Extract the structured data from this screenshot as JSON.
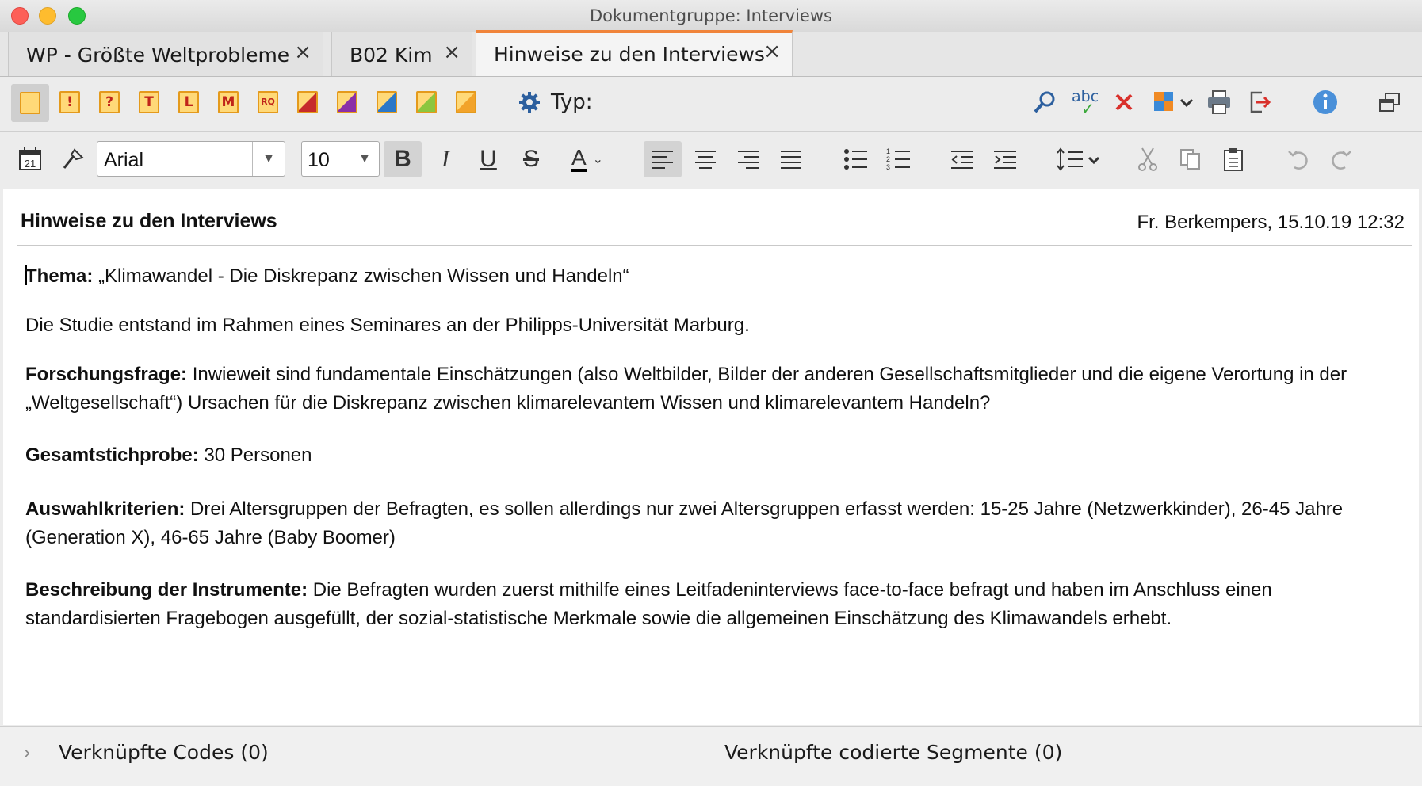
{
  "window": {
    "title": "Dokumentgruppe: Interviews"
  },
  "tabs": [
    {
      "label": "WP - Größte Weltprobleme",
      "close": "×"
    },
    {
      "label": "B02 Kim",
      "close": "×"
    },
    {
      "label": "Hinweise zu den Interviews",
      "close": "×",
      "active": true
    }
  ],
  "toolbar": {
    "memo_types": [
      {
        "icon": "memo-blank-icon",
        "label": ""
      },
      {
        "icon": "memo-exclamation-icon",
        "label": "!"
      },
      {
        "icon": "memo-question-icon",
        "label": "?"
      },
      {
        "icon": "memo-t-icon",
        "label": "T"
      },
      {
        "icon": "memo-l-icon",
        "label": "L"
      },
      {
        "icon": "memo-m-icon",
        "label": "M"
      },
      {
        "icon": "memo-rq-icon",
        "label": "RQ"
      },
      {
        "icon": "memo-red-corner-icon",
        "color": "#c62b2b"
      },
      {
        "icon": "memo-purple-corner-icon",
        "color": "#8b2fa8"
      },
      {
        "icon": "memo-blue-corner-icon",
        "color": "#2c78c8"
      },
      {
        "icon": "memo-green-corner-icon",
        "color": "#8cc63f"
      },
      {
        "icon": "memo-orange-corner-icon",
        "color": "#f2a32a"
      }
    ],
    "type_label": "Typ:",
    "spell_label": "abc"
  },
  "format": {
    "calendar_day": "21",
    "font_name": "Arial",
    "font_size": "10",
    "bold": "B",
    "italic": "I",
    "underline": "U",
    "strike": "S",
    "text_color": "A"
  },
  "document": {
    "title": "Hinweise zu den Interviews",
    "meta": "Fr. Berkempers, 15.10.19 12:32",
    "paragraphs": [
      {
        "label": "Thema:",
        "text": " „Klimawandel - Die Diskrepanz zwischen Wissen und Handeln“"
      },
      {
        "label": "",
        "text": "Die Studie entstand im Rahmen eines Seminares an der Philipps-Universität Marburg."
      },
      {
        "label": "Forschungsfrage:",
        "text": " Inwieweit sind fundamentale Einschätzungen (also Weltbilder, Bilder der anderen Gesellschaftsmitglieder und die eigene Verortung in der „Weltgesellschaft“) Ursachen für die Diskrepanz zwischen klimarelevantem Wissen und klimarelevantem Handeln?"
      },
      {
        "label": "Gesamtstichprobe:",
        "text": " 30 Personen"
      },
      {
        "label": "Auswahlkriterien:",
        "text": " Drei Altersgruppen der Befragten, es sollen allerdings nur zwei Altersgruppen erfasst werden: 15-25 Jahre (Netzwerkkinder), 26-45 Jahre (Generation X), 46-65 Jahre (Baby Boomer)"
      },
      {
        "label": "Beschreibung der Instrumente:",
        "text": " Die Befragten wurden zuerst mithilfe eines Leitfadeninterviews face-to-face befragt und haben im Anschluss einen standardisierten Fragebogen ausgefüllt, der sozial-statistische Merkmale sowie die allgemeinen Einschätzung des Klimawandels erhebt."
      }
    ]
  },
  "footer": {
    "linked_codes": "Verknüpfte Codes (0)",
    "linked_segments": "Verknüpfte codierte Segmente (0)"
  }
}
